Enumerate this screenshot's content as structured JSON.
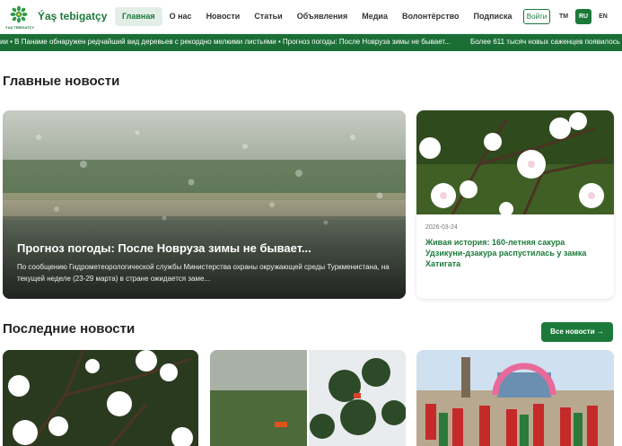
{
  "header": {
    "brand": "Ýaş tebigatçy",
    "logo_subtext": "ÝAŞ TEBIGATÇY",
    "nav": [
      {
        "label": "Главная",
        "active": true
      },
      {
        "label": "О нас",
        "active": false
      },
      {
        "label": "Новости",
        "active": false
      },
      {
        "label": "Статьи",
        "active": false
      },
      {
        "label": "Объявления",
        "active": false
      },
      {
        "label": "Медиа",
        "active": false
      },
      {
        "label": "Волонтёрство",
        "active": false
      },
      {
        "label": "Подписка",
        "active": false
      }
    ],
    "login_label": "Войти",
    "languages": [
      "TM",
      "RU",
      "EN"
    ],
    "active_language": "RU"
  },
  "ticker": {
    "text_left": "ии • В Панаме обнаружен редчайший вид деревьев с рекордно мелкими листьями • Прогноз погоды: После Новруза зимы не бывает...",
    "text_right": "Более 611 тысяч новых саженцев появилось в"
  },
  "sections": {
    "main_title": "Главные новости",
    "latest_title": "Последние новости",
    "all_news_label": "Все новости →"
  },
  "feature": {
    "title": "Прогноз погоды: После Новруза зимы не бывает...",
    "description": "По сообщению Гидрометеорологической службы Министерства охраны окружающей среды Туркменистана, на текущей неделе (23-29 марта) в стране ожидается заме..."
  },
  "side_card": {
    "date": "2026-03-24",
    "title": "Живая история: 160-летняя сакура Удзикуни-дзакура распустилась у замка Хатигата"
  },
  "colors": {
    "brand_green": "#1b7a3a",
    "ticker_green": "#1b6f36",
    "active_nav_bg": "#e3efe6"
  }
}
